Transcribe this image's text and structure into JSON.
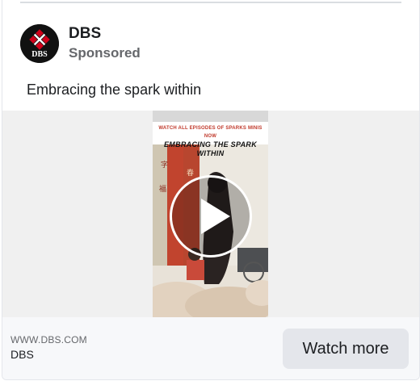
{
  "post": {
    "page_name": "DBS",
    "sponsored_label": "Sponsored",
    "caption": "Embracing the spark within",
    "avatar_logo_text": "DBS"
  },
  "video": {
    "banner_line1": "WATCH ALL EPISODES OF SPARKS MINIS NOW",
    "banner_line2": "EMBRACING THE SPARK WITHIN",
    "play_icon": "play-icon"
  },
  "footer": {
    "domain": "WWW.DBS.COM",
    "title": "DBS",
    "cta_label": "Watch more"
  },
  "colors": {
    "brand_red": "#d0021b",
    "cta_background": "#e4e6eb",
    "footer_background": "#f7f8fa"
  }
}
